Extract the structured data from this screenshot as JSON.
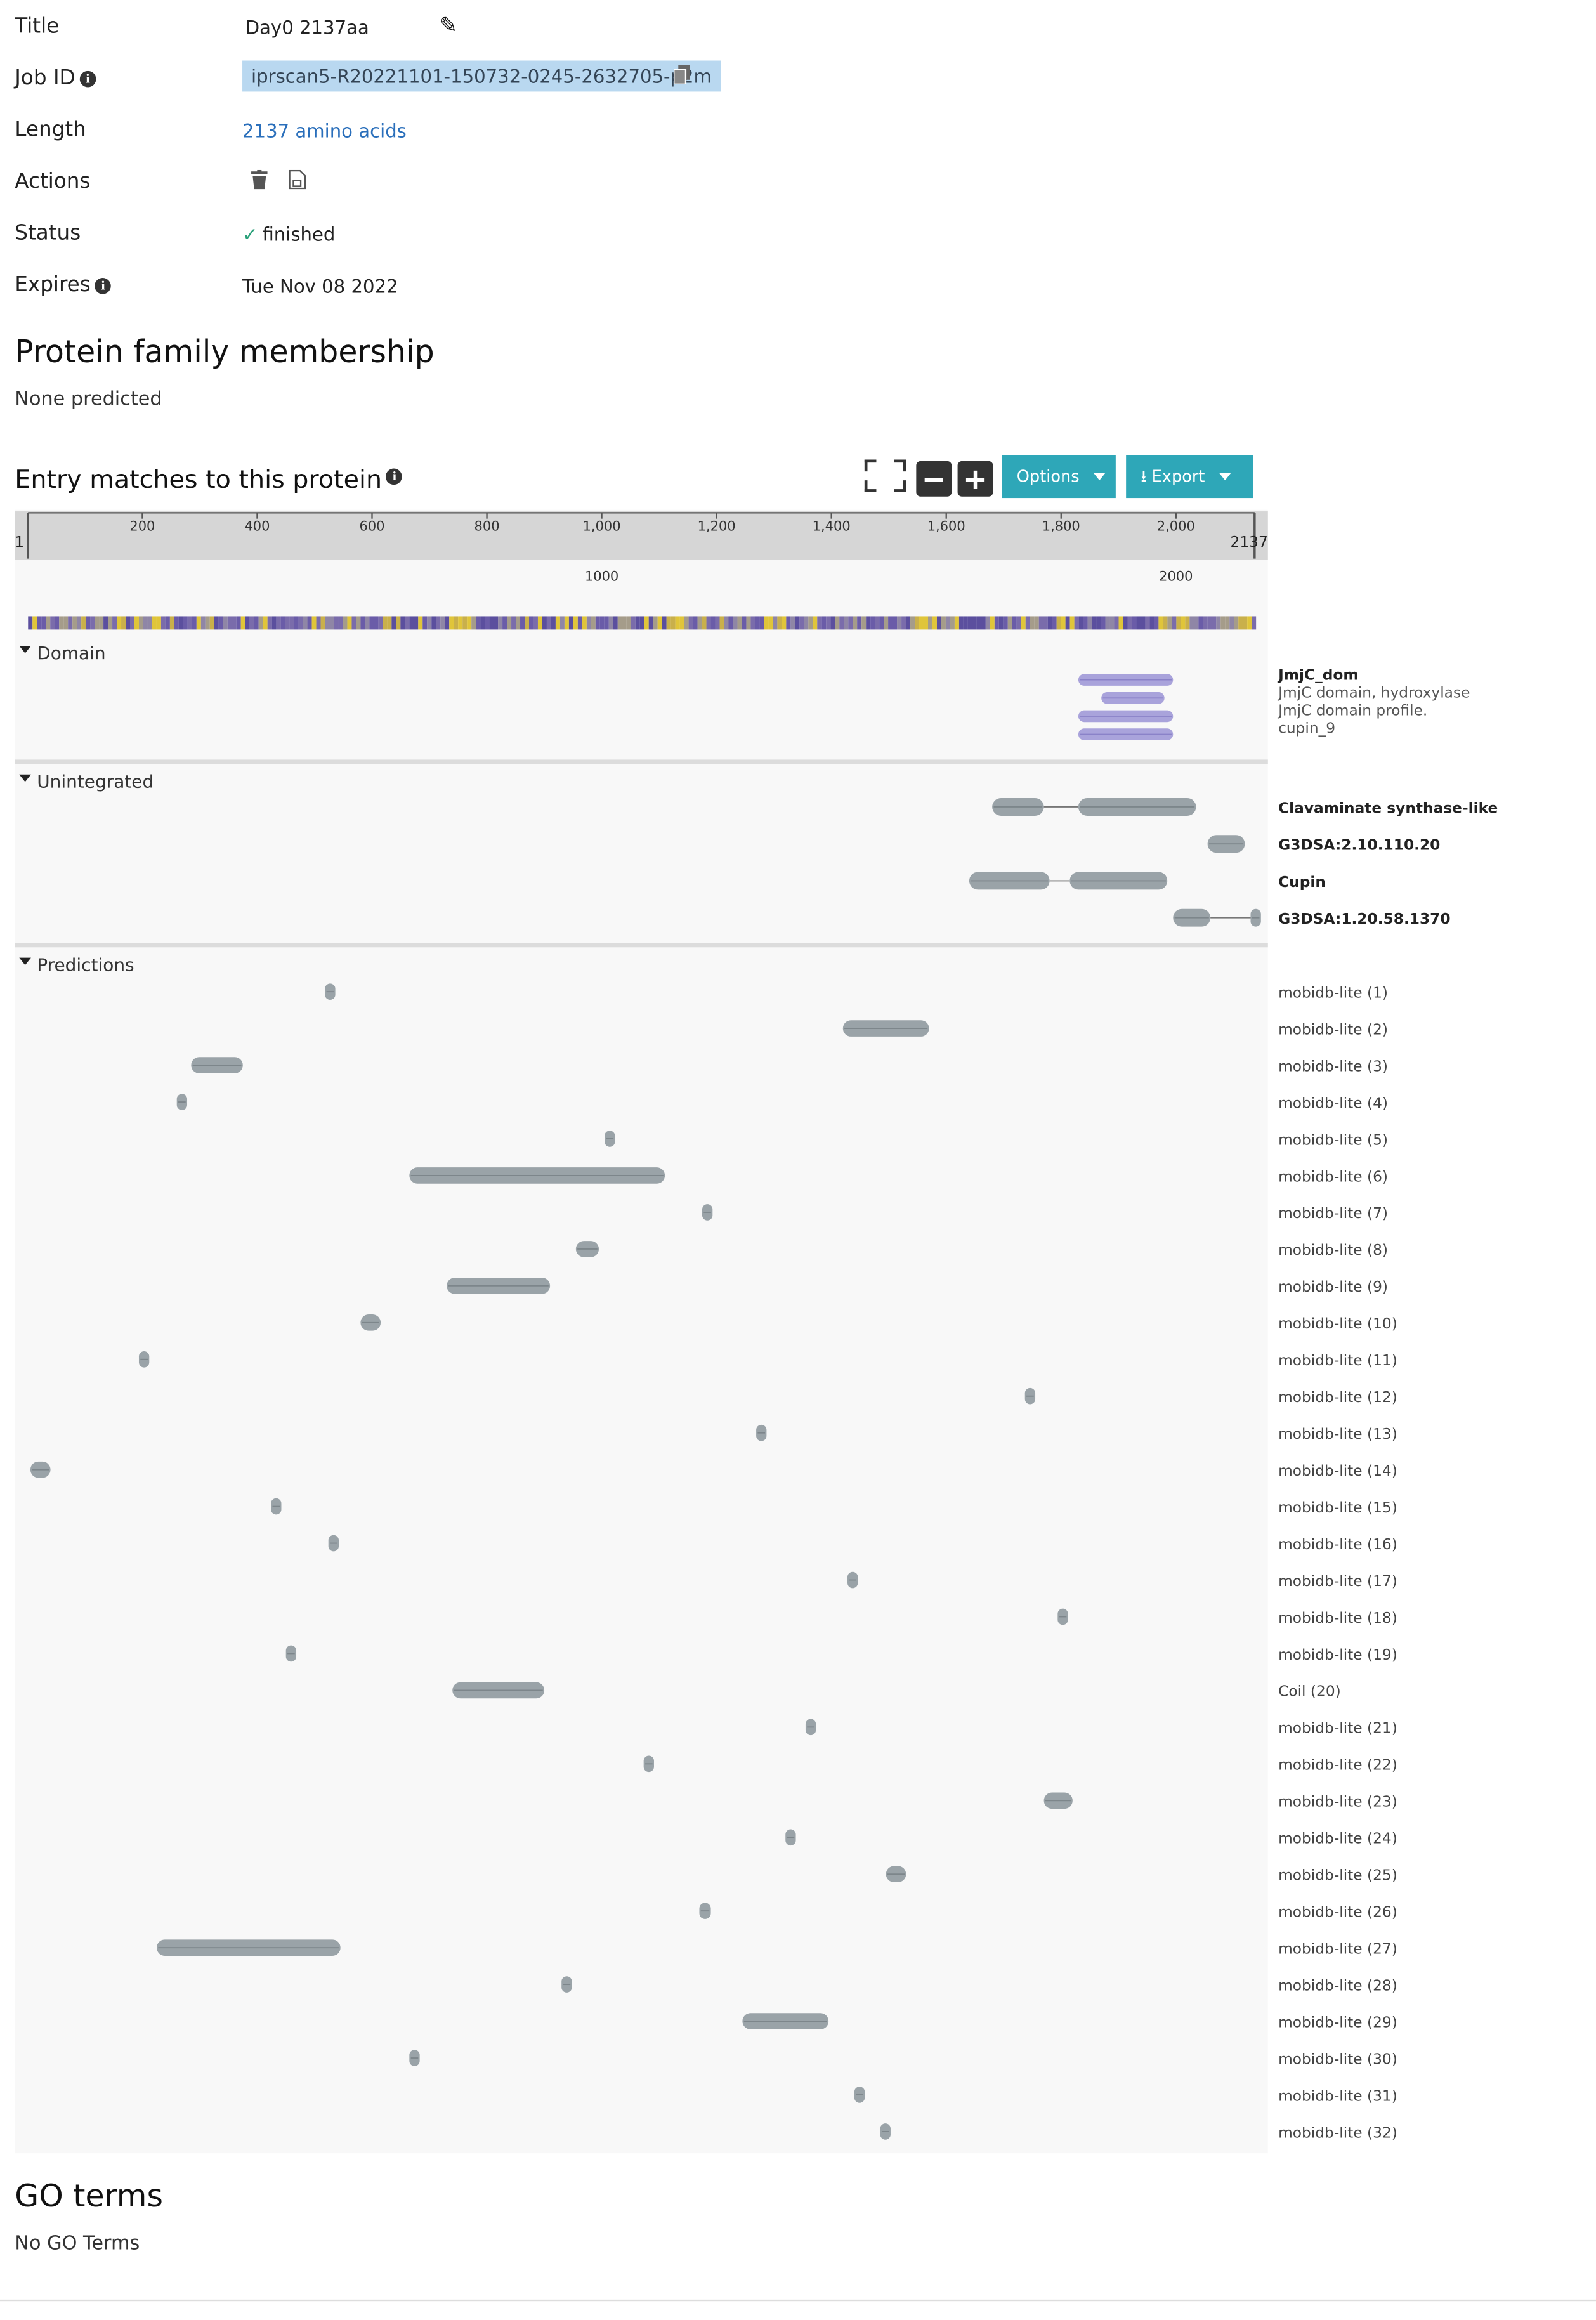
{
  "job": {
    "title_label": "Title",
    "title_value": "Day0 2137aa",
    "jobid_label": "Job ID",
    "jobid_value": "iprscan5-R20221101-150732-0245-2632705-p2m",
    "length_label": "Length",
    "length_value": "2137 amino acids",
    "actions_label": "Actions",
    "status_label": "Status",
    "status_value": "finished",
    "expires_label": "Expires",
    "expires_value": "Tue Nov 08 2022"
  },
  "family": {
    "heading": "Protein family membership",
    "text": "None predicted"
  },
  "entries": {
    "heading": "Entry matches to this protein",
    "options_label": "Options",
    "export_label": "Export"
  },
  "go": {
    "heading": "GO terms",
    "text": "No GO Terms"
  },
  "chart_data": {
    "type": "feature-track",
    "sequence_length": 2137,
    "axis": {
      "start_label": "1",
      "end_label": "2137",
      "ticks": [
        "200",
        "400",
        "600",
        "800",
        "1,000",
        "1,200",
        "1,400",
        "1,600",
        "1,800",
        "2,000"
      ],
      "tick_values": [
        200,
        400,
        600,
        800,
        1000,
        1200,
        1400,
        1600,
        1800,
        2000
      ],
      "secondary_ticks": [
        "1000",
        "2000"
      ],
      "secondary_values": [
        1000,
        2000
      ]
    },
    "colors": {
      "domain": "#a9a3db",
      "feature": "#9aa3a8",
      "sequence_low": "#5b4f9e",
      "sequence_high": "#e0c53a"
    },
    "sections": [
      {
        "name": "Domain",
        "label_entries": [
          "JmjC_dom",
          "JmjC domain, hydroxylase",
          "JmjC domain profile.",
          "cupin_9"
        ],
        "rows": [
          {
            "fragments": [
              [
                1830,
                1995
              ]
            ]
          },
          {
            "fragments": [
              [
                1870,
                1980
              ]
            ]
          },
          {
            "fragments": [
              [
                1830,
                1995
              ]
            ]
          },
          {
            "fragments": [
              [
                1830,
                1995
              ]
            ]
          }
        ]
      },
      {
        "name": "Unintegrated",
        "rows": [
          {
            "label": "Clavaminate synthase-like",
            "fragments": [
              [
                1680,
                1770
              ],
              [
                1830,
                2035
              ]
            ]
          },
          {
            "label": "G3DSA:2.10.110.20",
            "fragments": [
              [
                2055,
                2120
              ]
            ]
          },
          {
            "label": "Cupin",
            "fragments": [
              [
                1640,
                1780
              ],
              [
                1815,
                1985
              ]
            ]
          },
          {
            "label": "G3DSA:1.20.58.1370",
            "fragments": [
              [
                1995,
                2060
              ],
              [
                2130,
                2137
              ]
            ]
          }
        ]
      },
      {
        "name": "Predictions",
        "rows": [
          {
            "label": "mobidb-lite (1)",
            "fragments": [
              [
                518,
                525
              ]
            ]
          },
          {
            "label": "mobidb-lite (2)",
            "fragments": [
              [
                1420,
                1570
              ]
            ]
          },
          {
            "label": "mobidb-lite (3)",
            "fragments": [
              [
                285,
                375
              ]
            ]
          },
          {
            "label": "mobidb-lite (4)",
            "fragments": [
              [
                260,
                272
              ]
            ]
          },
          {
            "label": "mobidb-lite (5)",
            "fragments": [
              [
                1005,
                1020
              ]
            ]
          },
          {
            "label": "mobidb-lite (6)",
            "fragments": [
              [
                665,
                1110
              ]
            ]
          },
          {
            "label": "mobidb-lite (7)",
            "fragments": [
              [
                1175,
                1190
              ]
            ]
          },
          {
            "label": "mobidb-lite (8)",
            "fragments": [
              [
                955,
                995
              ]
            ]
          },
          {
            "label": "mobidb-lite (9)",
            "fragments": [
              [
                730,
                910
              ]
            ]
          },
          {
            "label": "mobidb-lite (10)",
            "fragments": [
              [
                580,
                615
              ]
            ]
          },
          {
            "label": "mobidb-lite (11)",
            "fragments": [
              [
                194,
                206
              ]
            ]
          },
          {
            "label": "mobidb-lite (12)",
            "fragments": [
              [
                1737,
                1749
              ]
            ]
          },
          {
            "label": "mobidb-lite (13)",
            "fragments": [
              [
                1269,
                1283
              ]
            ]
          },
          {
            "label": "mobidb-lite (14)",
            "fragments": [
              [
                5,
                40
              ]
            ]
          },
          {
            "label": "mobidb-lite (15)",
            "fragments": [
              [
                424,
                436
              ]
            ]
          },
          {
            "label": "mobidb-lite (16)",
            "fragments": [
              [
                524,
                534
              ]
            ]
          },
          {
            "label": "mobidb-lite (17)",
            "fragments": [
              [
                1428,
                1436
              ]
            ]
          },
          {
            "label": "mobidb-lite (18)",
            "fragments": [
              [
                1794,
                1804
              ]
            ]
          },
          {
            "label": "mobidb-lite (19)",
            "fragments": [
              [
                450,
                460
              ]
            ]
          },
          {
            "label": "Coil (20)",
            "fragments": [
              [
                740,
                900
              ]
            ]
          },
          {
            "label": "mobidb-lite (21)",
            "fragments": [
              [
                1355,
                1365
              ]
            ]
          },
          {
            "label": "mobidb-lite (22)",
            "fragments": [
              [
                1073,
                1083
              ]
            ]
          },
          {
            "label": "mobidb-lite (23)",
            "fragments": [
              [
                1770,
                1820
              ]
            ]
          },
          {
            "label": "mobidb-lite (24)",
            "fragments": [
              [
                1320,
                1332
              ]
            ]
          },
          {
            "label": "mobidb-lite (25)",
            "fragments": [
              [
                1495,
                1530
              ]
            ]
          },
          {
            "label": "mobidb-lite (26)",
            "fragments": [
              [
                1170,
                1190
              ]
            ]
          },
          {
            "label": "mobidb-lite (27)",
            "fragments": [
              [
                225,
                545
              ]
            ]
          },
          {
            "label": "mobidb-lite (28)",
            "fragments": [
              [
                930,
                940
              ]
            ]
          },
          {
            "label": "mobidb-lite (29)",
            "fragments": [
              [
                1245,
                1395
              ]
            ]
          },
          {
            "label": "mobidb-lite (30)",
            "fragments": [
              [
                665,
                675
              ]
            ]
          },
          {
            "label": "mobidb-lite (31)",
            "fragments": [
              [
                1440,
                1455
              ]
            ]
          },
          {
            "label": "mobidb-lite (32)",
            "fragments": [
              [
                1485,
                1495
              ]
            ]
          }
        ]
      }
    ]
  }
}
